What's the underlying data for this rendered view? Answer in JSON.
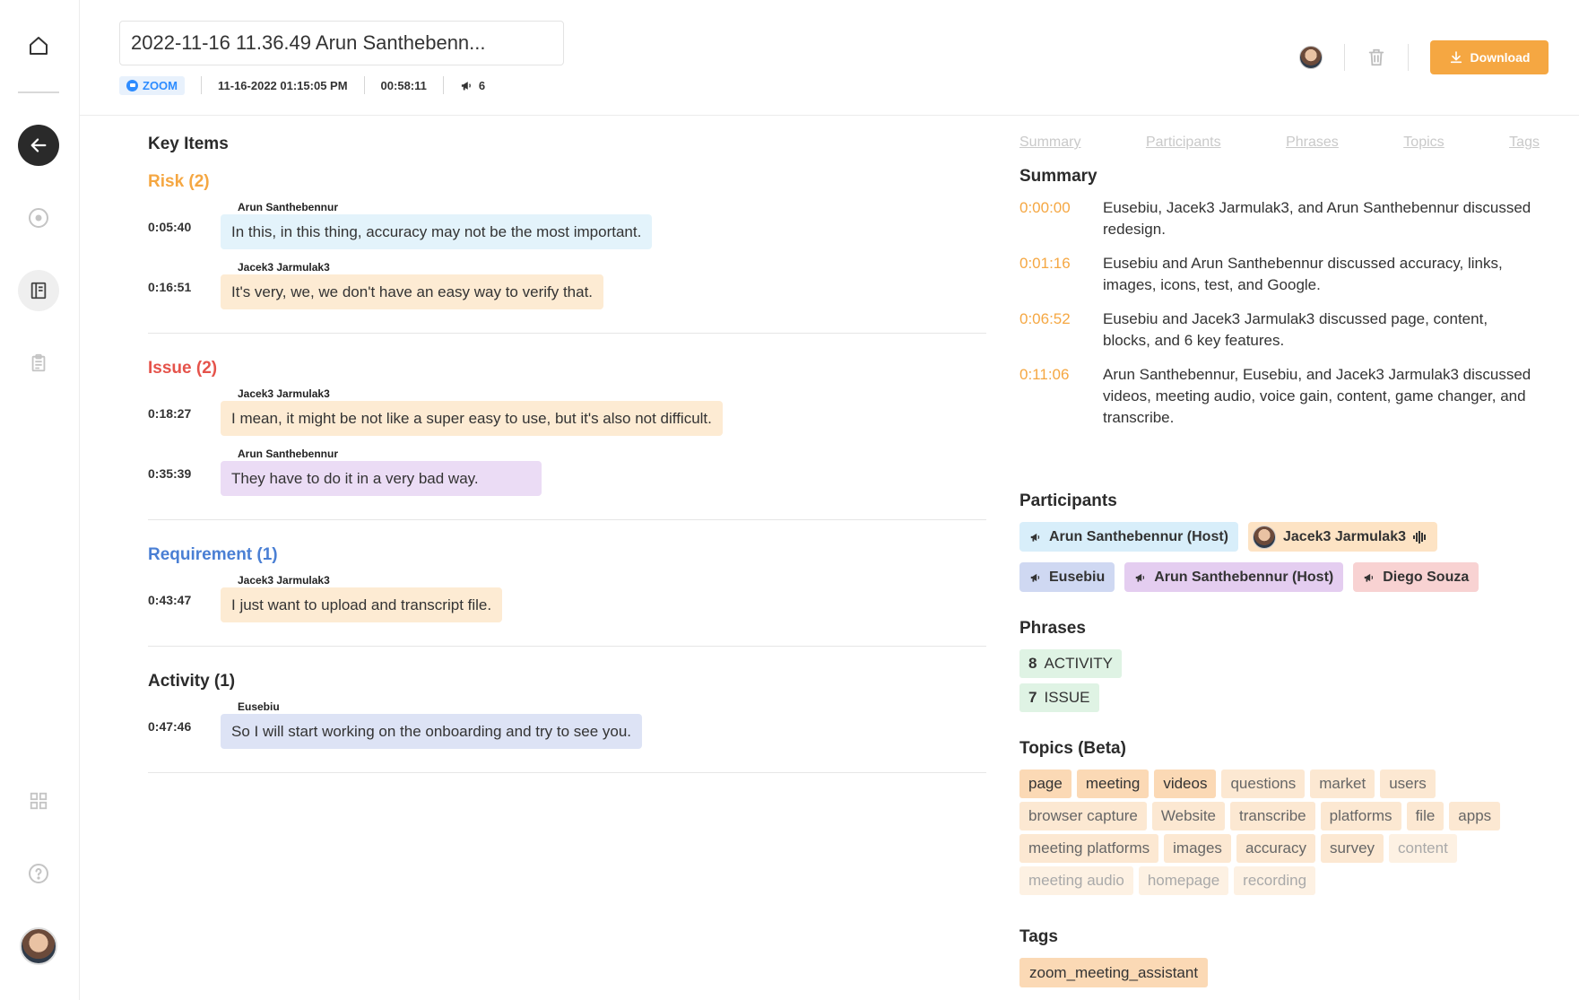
{
  "header": {
    "title": "2022-11-16 11.36.49 Arun Santhebenn...",
    "source_badge": "ZOOM",
    "date": "11-16-2022 01:15:05 PM",
    "duration": "00:58:11",
    "speaker_count": "6",
    "download_label": "Download"
  },
  "key_items": {
    "title": "Key Items",
    "sections": [
      {
        "heading": "Risk (2)",
        "color": "#f5a742",
        "items": [
          {
            "time": "0:05:40",
            "speaker": "Arun Santhebennur",
            "text": "In this, in this thing, accuracy may not be the most important."
          },
          {
            "time": "0:16:51",
            "speaker": "Jacek3 Jarmulak3",
            "text": "It's very, we, we don't have an easy way to verify that."
          }
        ]
      },
      {
        "heading": "Issue (2)",
        "color": "#e5534b",
        "items": [
          {
            "time": "0:18:27",
            "speaker": "Jacek3 Jarmulak3",
            "text": "I mean, it might be not like a super easy to use, but it's also not difficult."
          },
          {
            "time": "0:35:39",
            "speaker": "Arun Santhebennur",
            "text": "They have to do it in a very bad way."
          }
        ]
      },
      {
        "heading": "Requirement (1)",
        "color": "#4a7fd4",
        "items": [
          {
            "time": "0:43:47",
            "speaker": "Jacek3 Jarmulak3",
            "text": "I just want to upload and transcript file."
          }
        ]
      },
      {
        "heading": "Activity (1)",
        "color": "#2b2b2b",
        "items": [
          {
            "time": "0:47:46",
            "speaker": "Eusebiu",
            "text": "So I will start working on the onboarding and try to see you."
          }
        ]
      }
    ]
  },
  "tabs": [
    "Summary",
    "Participants",
    "Phrases",
    "Topics",
    "Tags"
  ],
  "summary": {
    "title": "Summary",
    "rows": [
      {
        "time": "0:00:00",
        "text": "Eusebiu, Jacek3 Jarmulak3, and Arun Santhebennur discussed redesign."
      },
      {
        "time": "0:01:16",
        "text": "Eusebiu and Arun Santhebennur discussed accuracy, links, images, icons, test, and Google."
      },
      {
        "time": "0:06:52",
        "text": "Eusebiu and Jacek3 Jarmulak3 discussed page, content, blocks, and 6 key features."
      },
      {
        "time": "0:11:06",
        "text": "Arun Santhebennur, Eusebiu, and Jacek3 Jarmulak3 discussed videos, meeting audio, voice gain, content, game changer, and transcribe."
      }
    ]
  },
  "participants": {
    "title": "Participants",
    "items": [
      {
        "name": "Arun Santhebennur (Host)"
      },
      {
        "name": "Jacek3 Jarmulak3"
      },
      {
        "name": "Eusebiu"
      },
      {
        "name": "Arun Santhebennur (Host)"
      },
      {
        "name": "Diego Souza"
      }
    ]
  },
  "phrases": {
    "title": "Phrases",
    "items": [
      {
        "count": "8",
        "label": "ACTIVITY"
      },
      {
        "count": "7",
        "label": "ISSUE"
      }
    ]
  },
  "topics": {
    "title": "Topics (Beta)",
    "items": [
      {
        "label": "page",
        "weight": 1
      },
      {
        "label": "meeting",
        "weight": 1
      },
      {
        "label": "videos",
        "weight": 1
      },
      {
        "label": "questions",
        "weight": 2
      },
      {
        "label": "market",
        "weight": 2
      },
      {
        "label": "users",
        "weight": 2
      },
      {
        "label": "browser capture",
        "weight": 2
      },
      {
        "label": "Website",
        "weight": 2
      },
      {
        "label": "transcribe",
        "weight": 2
      },
      {
        "label": "platforms",
        "weight": 2
      },
      {
        "label": "file",
        "weight": 2
      },
      {
        "label": "apps",
        "weight": 2
      },
      {
        "label": "meeting platforms",
        "weight": 2
      },
      {
        "label": "images",
        "weight": 2
      },
      {
        "label": "accuracy",
        "weight": 2
      },
      {
        "label": "survey",
        "weight": 2
      },
      {
        "label": "content",
        "weight": 3
      },
      {
        "label": "meeting audio",
        "weight": 3
      },
      {
        "label": "homepage",
        "weight": 3
      },
      {
        "label": "recording",
        "weight": 3
      }
    ]
  },
  "tags": {
    "title": "Tags",
    "items": [
      "zoom_meeting_assistant"
    ]
  },
  "icons": {
    "rail": [
      "home-icon",
      "back-arrow-icon",
      "record-icon",
      "notebook-icon",
      "clipboard-icon",
      "grid-icon",
      "help-icon"
    ],
    "header": [
      "trash-icon",
      "download-icon",
      "megaphone-icon"
    ]
  },
  "colors": {
    "accent": "#f5a742",
    "zoom": "#2d8cff"
  }
}
